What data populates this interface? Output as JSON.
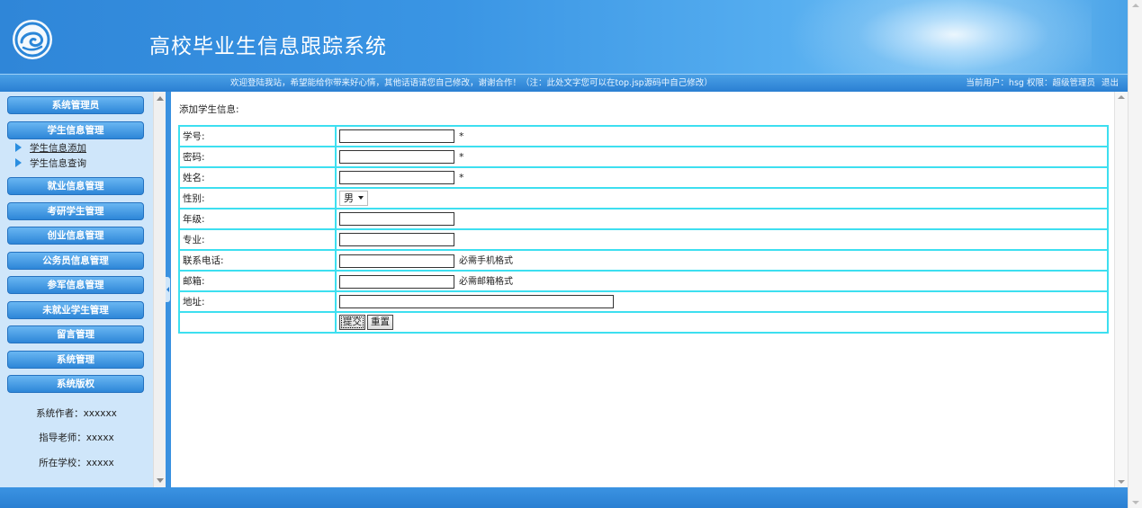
{
  "header": {
    "title": "高校毕业生信息跟踪系统",
    "welcome": "欢迎登陆我站，希望能给你带来好心情，其他话语请您自己修改，谢谢合作！（注：此处文字您可以在top.jsp源码中自己修改）",
    "user_info": "当前用户：hsg 权限：超级管理员",
    "logout": "退出"
  },
  "sidebar": {
    "menus": [
      {
        "label": "系统管理员"
      },
      {
        "label": "学生信息管理"
      },
      {
        "label": "就业信息管理"
      },
      {
        "label": "考研学生管理"
      },
      {
        "label": "创业信息管理"
      },
      {
        "label": "公务员信息管理"
      },
      {
        "label": "参军信息管理"
      },
      {
        "label": "未就业学生管理"
      },
      {
        "label": "留言管理"
      },
      {
        "label": "系统管理"
      },
      {
        "label": "系统版权"
      }
    ],
    "sub_items": [
      {
        "label": "学生信息添加"
      },
      {
        "label": "学生信息查询"
      }
    ],
    "credits": [
      "系统作者：xxxxxx",
      "指导老师：xxxxx",
      "所在学校：xxxxx"
    ]
  },
  "form": {
    "title": "添加学生信息:",
    "fields": [
      {
        "label": "学号:",
        "value": "",
        "note": "*"
      },
      {
        "label": "密码:",
        "value": "",
        "note": "*"
      },
      {
        "label": "姓名:",
        "value": "",
        "note": "*"
      },
      {
        "label": "性别:",
        "selected": "男"
      },
      {
        "label": "年级:",
        "value": ""
      },
      {
        "label": "专业:",
        "value": ""
      },
      {
        "label": "联系电话:",
        "value": "",
        "note": "必需手机格式"
      },
      {
        "label": "邮箱:",
        "value": "",
        "note": "必需邮箱格式"
      },
      {
        "label": "地址:",
        "value": ""
      }
    ],
    "submit_label": "提交",
    "reset_label": "重置"
  }
}
